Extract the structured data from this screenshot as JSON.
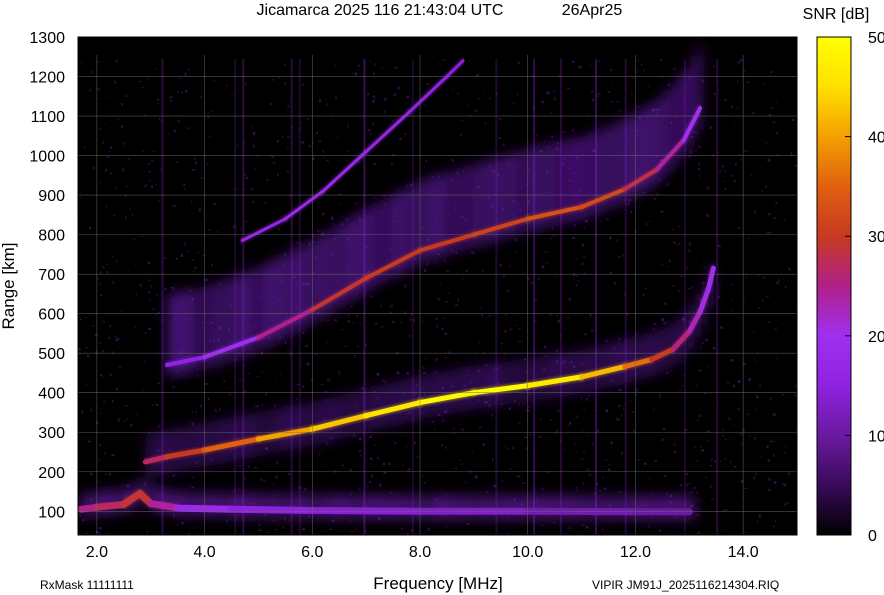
{
  "chart_data": {
    "type": "heatmap",
    "title": "Jicamarca 2025 116 21:43:04 UTC",
    "date_label": "26Apr25",
    "xlabel": "Frequency [MHz]",
    "ylabel": "Range [km]",
    "xlim": [
      1.65,
      15.0
    ],
    "ylim": [
      40,
      1300
    ],
    "x_ticks": [
      {
        "value": 2.0,
        "label": "2.0"
      },
      {
        "value": 4.0,
        "label": "4.0"
      },
      {
        "value": 6.0,
        "label": "6.0"
      },
      {
        "value": 8.0,
        "label": "8.0"
      },
      {
        "value": 10.0,
        "label": "10.0"
      },
      {
        "value": 12.0,
        "label": "12.0"
      },
      {
        "value": 14.0,
        "label": "14.0"
      }
    ],
    "y_ticks": [
      {
        "value": 100,
        "label": "100"
      },
      {
        "value": 200,
        "label": "200"
      },
      {
        "value": 300,
        "label": "300"
      },
      {
        "value": 400,
        "label": "400"
      },
      {
        "value": 500,
        "label": "500"
      },
      {
        "value": 600,
        "label": "600"
      },
      {
        "value": 700,
        "label": "700"
      },
      {
        "value": 800,
        "label": "800"
      },
      {
        "value": 900,
        "label": "900"
      },
      {
        "value": 1000,
        "label": "1000"
      },
      {
        "value": 1100,
        "label": "1100"
      },
      {
        "value": 1200,
        "label": "1200"
      },
      {
        "value": 1300,
        "label": "1300"
      }
    ],
    "grid": true,
    "colorbar": {
      "label": "SNR [dB]",
      "min": 0,
      "max": 50,
      "ticks": [
        {
          "value": 0,
          "label": "0"
        },
        {
          "value": 10,
          "label": "10"
        },
        {
          "value": 20,
          "label": "20"
        },
        {
          "value": 30,
          "label": "30"
        },
        {
          "value": 40,
          "label": "40"
        },
        {
          "value": 50,
          "label": "50"
        }
      ],
      "colors": [
        "#000000",
        "#3a0a5a",
        "#6a1aa0",
        "#8f22e0",
        "#a030f0",
        "#b0208a",
        "#c83a20",
        "#e06010",
        "#f3a000",
        "#ffe000",
        "#ffff00"
      ]
    },
    "series": [
      {
        "name": "",
        "trace": "first-hop echo",
        "points": [
          [
            2.9,
            225
          ],
          [
            3.3,
            238
          ],
          [
            4.0,
            255
          ],
          [
            5.0,
            283
          ],
          [
            6.0,
            308
          ],
          [
            7.0,
            342
          ],
          [
            8.0,
            375
          ],
          [
            9.0,
            400
          ],
          [
            10.0,
            418
          ],
          [
            11.0,
            440
          ],
          [
            11.8,
            466
          ],
          [
            12.3,
            484
          ],
          [
            12.7,
            510
          ],
          [
            13.0,
            555
          ],
          [
            13.2,
            605
          ],
          [
            13.35,
            660
          ],
          [
            13.45,
            715
          ]
        ],
        "snr": [
          26,
          28,
          32,
          38,
          42,
          44,
          48,
          50,
          49,
          44,
          40,
          32,
          28,
          24,
          22,
          20,
          18
        ]
      },
      {
        "name": "",
        "trace": "second-hop echo",
        "points": [
          [
            3.3,
            470
          ],
          [
            4.0,
            490
          ],
          [
            5.0,
            540
          ],
          [
            6.0,
            610
          ],
          [
            7.0,
            690
          ],
          [
            8.0,
            760
          ],
          [
            9.0,
            800
          ],
          [
            10.0,
            840
          ],
          [
            11.0,
            870
          ],
          [
            11.8,
            915
          ],
          [
            12.4,
            965
          ],
          [
            12.9,
            1040
          ],
          [
            13.2,
            1120
          ]
        ],
        "snr": [
          14,
          17,
          22,
          28,
          30,
          30,
          30,
          32,
          34,
          30,
          26,
          22,
          18
        ]
      },
      {
        "name": "",
        "trace": "third-hop echo",
        "points": [
          [
            4.7,
            785
          ],
          [
            5.5,
            840
          ],
          [
            6.2,
            910
          ],
          [
            7.0,
            1010
          ],
          [
            7.8,
            1110
          ],
          [
            8.5,
            1200
          ],
          [
            8.8,
            1240
          ]
        ],
        "snr": [
          16,
          17,
          18,
          17,
          16,
          15,
          14
        ]
      },
      {
        "name": "",
        "trace": "sporadic-E / low layer echo",
        "points": [
          [
            1.7,
            105
          ],
          [
            2.0,
            110
          ],
          [
            2.5,
            118
          ],
          [
            2.8,
            145
          ],
          [
            3.0,
            120
          ],
          [
            3.5,
            108
          ],
          [
            4.5,
            105
          ],
          [
            6.0,
            102
          ],
          [
            8.0,
            100
          ],
          [
            10.0,
            100
          ],
          [
            12.0,
            99
          ],
          [
            13.0,
            99
          ]
        ],
        "snr": [
          24,
          26,
          28,
          30,
          28,
          20,
          16,
          14,
          14,
          12,
          10,
          10
        ]
      }
    ],
    "footer_left": "RxMask 11111111",
    "footer_right": "VIPIR  JM91J_2025116214304.RIQ"
  }
}
